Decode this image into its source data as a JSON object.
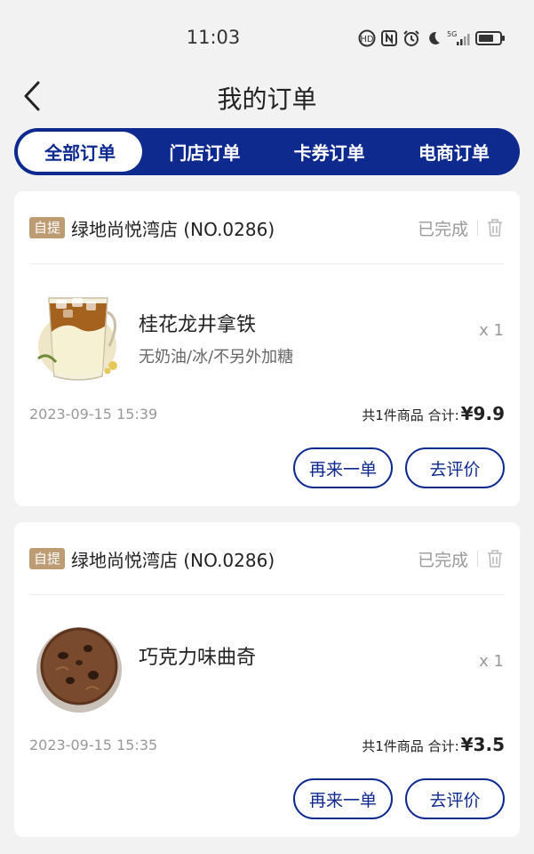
{
  "status_bar": {
    "time": "11:03"
  },
  "nav": {
    "title": "我的订单"
  },
  "tabs": [
    {
      "label": "全部订单",
      "active": true
    },
    {
      "label": "门店订单",
      "active": false
    },
    {
      "label": "卡券订单",
      "active": false
    },
    {
      "label": "电商订单",
      "active": false
    }
  ],
  "orders": [
    {
      "badge": "自提",
      "store": "绿地尚悦湾店 (NO.0286)",
      "status": "已完成",
      "product_image": "iced-osmanthus-latte",
      "product_name": "桂花龙井拿铁",
      "product_spec": "无奶油/冰/不另外加糖",
      "quantity": "x 1",
      "time": "2023-09-15 15:39",
      "total_label": "共1件商品 合计:",
      "total_amount": "¥9.9",
      "reorder_label": "再来一单",
      "review_label": "去评价"
    },
    {
      "badge": "自提",
      "store": "绿地尚悦湾店 (NO.0286)",
      "status": "已完成",
      "product_image": "chocolate-cookie",
      "product_name": "巧克力味曲奇",
      "product_spec": "",
      "quantity": "x 1",
      "time": "2023-09-15 15:35",
      "total_label": "共1件商品 合计:",
      "total_amount": "¥3.5",
      "reorder_label": "再来一单",
      "review_label": "去评价"
    }
  ],
  "colors": {
    "accent": "#0e2a8f",
    "badge": "#bd9b73",
    "background": "#f2f2f2"
  }
}
